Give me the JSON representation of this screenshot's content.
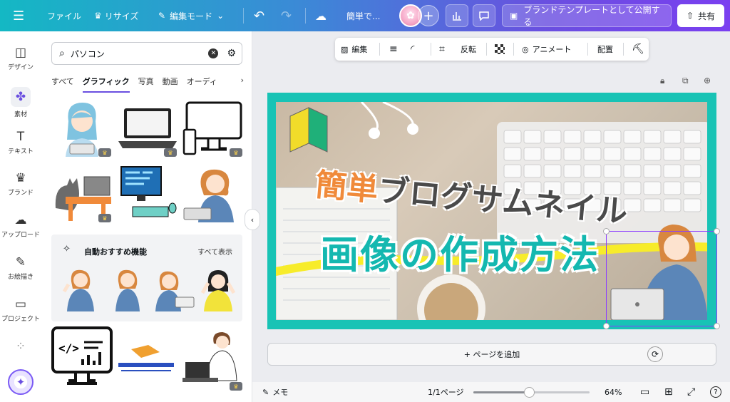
{
  "topbar": {
    "menu_icon": "hamburger-icon",
    "file_label": "ファイル",
    "resize_label": "リサイズ",
    "edit_mode_label": "編集モード",
    "doc_title": "簡単で...",
    "brand_template_label": "ブランドテンプレートとして公開する",
    "share_label": "共有"
  },
  "rail": {
    "items": [
      {
        "label": "デザイン",
        "icon": "layout-icon"
      },
      {
        "label": "素材",
        "icon": "elements-icon"
      },
      {
        "label": "テキスト",
        "icon": "text-icon"
      },
      {
        "label": "ブランド",
        "icon": "brand-icon"
      },
      {
        "label": "アップロード",
        "icon": "upload-icon"
      },
      {
        "label": "お絵描き",
        "icon": "draw-icon"
      },
      {
        "label": "プロジェクト",
        "icon": "folder-icon"
      },
      {
        "label": "",
        "icon": "apps-icon"
      }
    ]
  },
  "panel": {
    "search_value": "パソコン",
    "tabs": [
      "すべて",
      "グラフィック",
      "写真",
      "動画",
      "オーディ"
    ],
    "active_tab": "グラフィック",
    "recommend_title": "自動おすすめ機能",
    "recommend_all": "すべて表示"
  },
  "context_toolbar": {
    "edit_label": "編集",
    "flip_label": "反転",
    "animate_label": "アニメート",
    "position_label": "配置"
  },
  "canvas": {
    "accent_word": "簡単",
    "subtitle_rest": "ブログサムネイル",
    "main_title": "画像の作成方法"
  },
  "add_page_label": "+ ページを追加",
  "bottombar": {
    "notes_label": "メモ",
    "page_indicator": "1/1ページ",
    "zoom_label": "64%",
    "zoom_fraction": 0.48
  },
  "colors": {
    "frame": "#18c3b5",
    "title_teal": "#14b8b0",
    "accent_orange": "#f08a3a",
    "selection": "#8b3dff"
  }
}
